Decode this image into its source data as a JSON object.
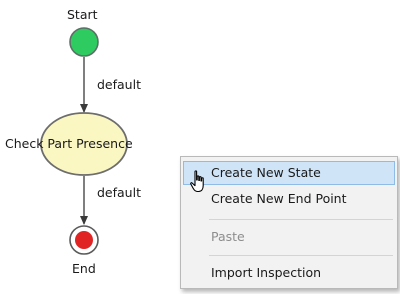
{
  "diagram": {
    "start_label": "Start",
    "edge1_label": "default",
    "state_label": "Check Part Presence",
    "edge2_label": "default",
    "end_label": "End",
    "colors": {
      "start_fill": "#2ecc60",
      "start_stroke": "#5e6f68",
      "state_fill": "#fbf7c3",
      "state_stroke": "#6d6d6d",
      "end_fill": "#e02424",
      "end_ring": "#ffffff",
      "end_stroke": "#5a5a5a",
      "edge_color": "#3a3a3a"
    }
  },
  "context_menu": {
    "items": [
      {
        "label": "Create New State",
        "state": "highlighted"
      },
      {
        "label": "Create New End Point",
        "state": "normal"
      },
      {
        "label": "Paste",
        "state": "disabled"
      },
      {
        "label": "Import Inspection",
        "state": "normal"
      }
    ],
    "highlight_color": "#cfe4f7"
  },
  "cursor": {
    "icon": "hand-pointer-icon"
  }
}
